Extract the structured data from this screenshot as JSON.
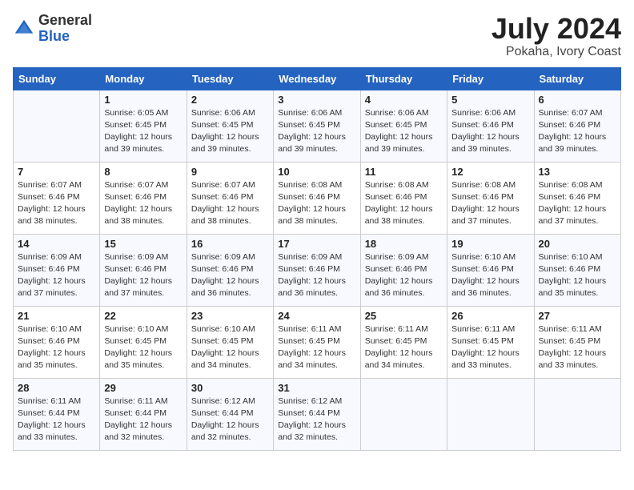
{
  "header": {
    "logo_general": "General",
    "logo_blue": "Blue",
    "title": "July 2024",
    "subtitle": "Pokaha, Ivory Coast"
  },
  "calendar": {
    "days_of_week": [
      "Sunday",
      "Monday",
      "Tuesday",
      "Wednesday",
      "Thursday",
      "Friday",
      "Saturday"
    ],
    "weeks": [
      [
        {
          "day": "",
          "detail": ""
        },
        {
          "day": "1",
          "detail": "Sunrise: 6:05 AM\nSunset: 6:45 PM\nDaylight: 12 hours\nand 39 minutes."
        },
        {
          "day": "2",
          "detail": "Sunrise: 6:06 AM\nSunset: 6:45 PM\nDaylight: 12 hours\nand 39 minutes."
        },
        {
          "day": "3",
          "detail": "Sunrise: 6:06 AM\nSunset: 6:45 PM\nDaylight: 12 hours\nand 39 minutes."
        },
        {
          "day": "4",
          "detail": "Sunrise: 6:06 AM\nSunset: 6:45 PM\nDaylight: 12 hours\nand 39 minutes."
        },
        {
          "day": "5",
          "detail": "Sunrise: 6:06 AM\nSunset: 6:46 PM\nDaylight: 12 hours\nand 39 minutes."
        },
        {
          "day": "6",
          "detail": "Sunrise: 6:07 AM\nSunset: 6:46 PM\nDaylight: 12 hours\nand 39 minutes."
        }
      ],
      [
        {
          "day": "7",
          "detail": "Sunrise: 6:07 AM\nSunset: 6:46 PM\nDaylight: 12 hours\nand 38 minutes."
        },
        {
          "day": "8",
          "detail": "Sunrise: 6:07 AM\nSunset: 6:46 PM\nDaylight: 12 hours\nand 38 minutes."
        },
        {
          "day": "9",
          "detail": "Sunrise: 6:07 AM\nSunset: 6:46 PM\nDaylight: 12 hours\nand 38 minutes."
        },
        {
          "day": "10",
          "detail": "Sunrise: 6:08 AM\nSunset: 6:46 PM\nDaylight: 12 hours\nand 38 minutes."
        },
        {
          "day": "11",
          "detail": "Sunrise: 6:08 AM\nSunset: 6:46 PM\nDaylight: 12 hours\nand 38 minutes."
        },
        {
          "day": "12",
          "detail": "Sunrise: 6:08 AM\nSunset: 6:46 PM\nDaylight: 12 hours\nand 37 minutes."
        },
        {
          "day": "13",
          "detail": "Sunrise: 6:08 AM\nSunset: 6:46 PM\nDaylight: 12 hours\nand 37 minutes."
        }
      ],
      [
        {
          "day": "14",
          "detail": "Sunrise: 6:09 AM\nSunset: 6:46 PM\nDaylight: 12 hours\nand 37 minutes."
        },
        {
          "day": "15",
          "detail": "Sunrise: 6:09 AM\nSunset: 6:46 PM\nDaylight: 12 hours\nand 37 minutes."
        },
        {
          "day": "16",
          "detail": "Sunrise: 6:09 AM\nSunset: 6:46 PM\nDaylight: 12 hours\nand 36 minutes."
        },
        {
          "day": "17",
          "detail": "Sunrise: 6:09 AM\nSunset: 6:46 PM\nDaylight: 12 hours\nand 36 minutes."
        },
        {
          "day": "18",
          "detail": "Sunrise: 6:09 AM\nSunset: 6:46 PM\nDaylight: 12 hours\nand 36 minutes."
        },
        {
          "day": "19",
          "detail": "Sunrise: 6:10 AM\nSunset: 6:46 PM\nDaylight: 12 hours\nand 36 minutes."
        },
        {
          "day": "20",
          "detail": "Sunrise: 6:10 AM\nSunset: 6:46 PM\nDaylight: 12 hours\nand 35 minutes."
        }
      ],
      [
        {
          "day": "21",
          "detail": "Sunrise: 6:10 AM\nSunset: 6:46 PM\nDaylight: 12 hours\nand 35 minutes."
        },
        {
          "day": "22",
          "detail": "Sunrise: 6:10 AM\nSunset: 6:45 PM\nDaylight: 12 hours\nand 35 minutes."
        },
        {
          "day": "23",
          "detail": "Sunrise: 6:10 AM\nSunset: 6:45 PM\nDaylight: 12 hours\nand 34 minutes."
        },
        {
          "day": "24",
          "detail": "Sunrise: 6:11 AM\nSunset: 6:45 PM\nDaylight: 12 hours\nand 34 minutes."
        },
        {
          "day": "25",
          "detail": "Sunrise: 6:11 AM\nSunset: 6:45 PM\nDaylight: 12 hours\nand 34 minutes."
        },
        {
          "day": "26",
          "detail": "Sunrise: 6:11 AM\nSunset: 6:45 PM\nDaylight: 12 hours\nand 33 minutes."
        },
        {
          "day": "27",
          "detail": "Sunrise: 6:11 AM\nSunset: 6:45 PM\nDaylight: 12 hours\nand 33 minutes."
        }
      ],
      [
        {
          "day": "28",
          "detail": "Sunrise: 6:11 AM\nSunset: 6:44 PM\nDaylight: 12 hours\nand 33 minutes."
        },
        {
          "day": "29",
          "detail": "Sunrise: 6:11 AM\nSunset: 6:44 PM\nDaylight: 12 hours\nand 32 minutes."
        },
        {
          "day": "30",
          "detail": "Sunrise: 6:12 AM\nSunset: 6:44 PM\nDaylight: 12 hours\nand 32 minutes."
        },
        {
          "day": "31",
          "detail": "Sunrise: 6:12 AM\nSunset: 6:44 PM\nDaylight: 12 hours\nand 32 minutes."
        },
        {
          "day": "",
          "detail": ""
        },
        {
          "day": "",
          "detail": ""
        },
        {
          "day": "",
          "detail": ""
        }
      ]
    ]
  }
}
